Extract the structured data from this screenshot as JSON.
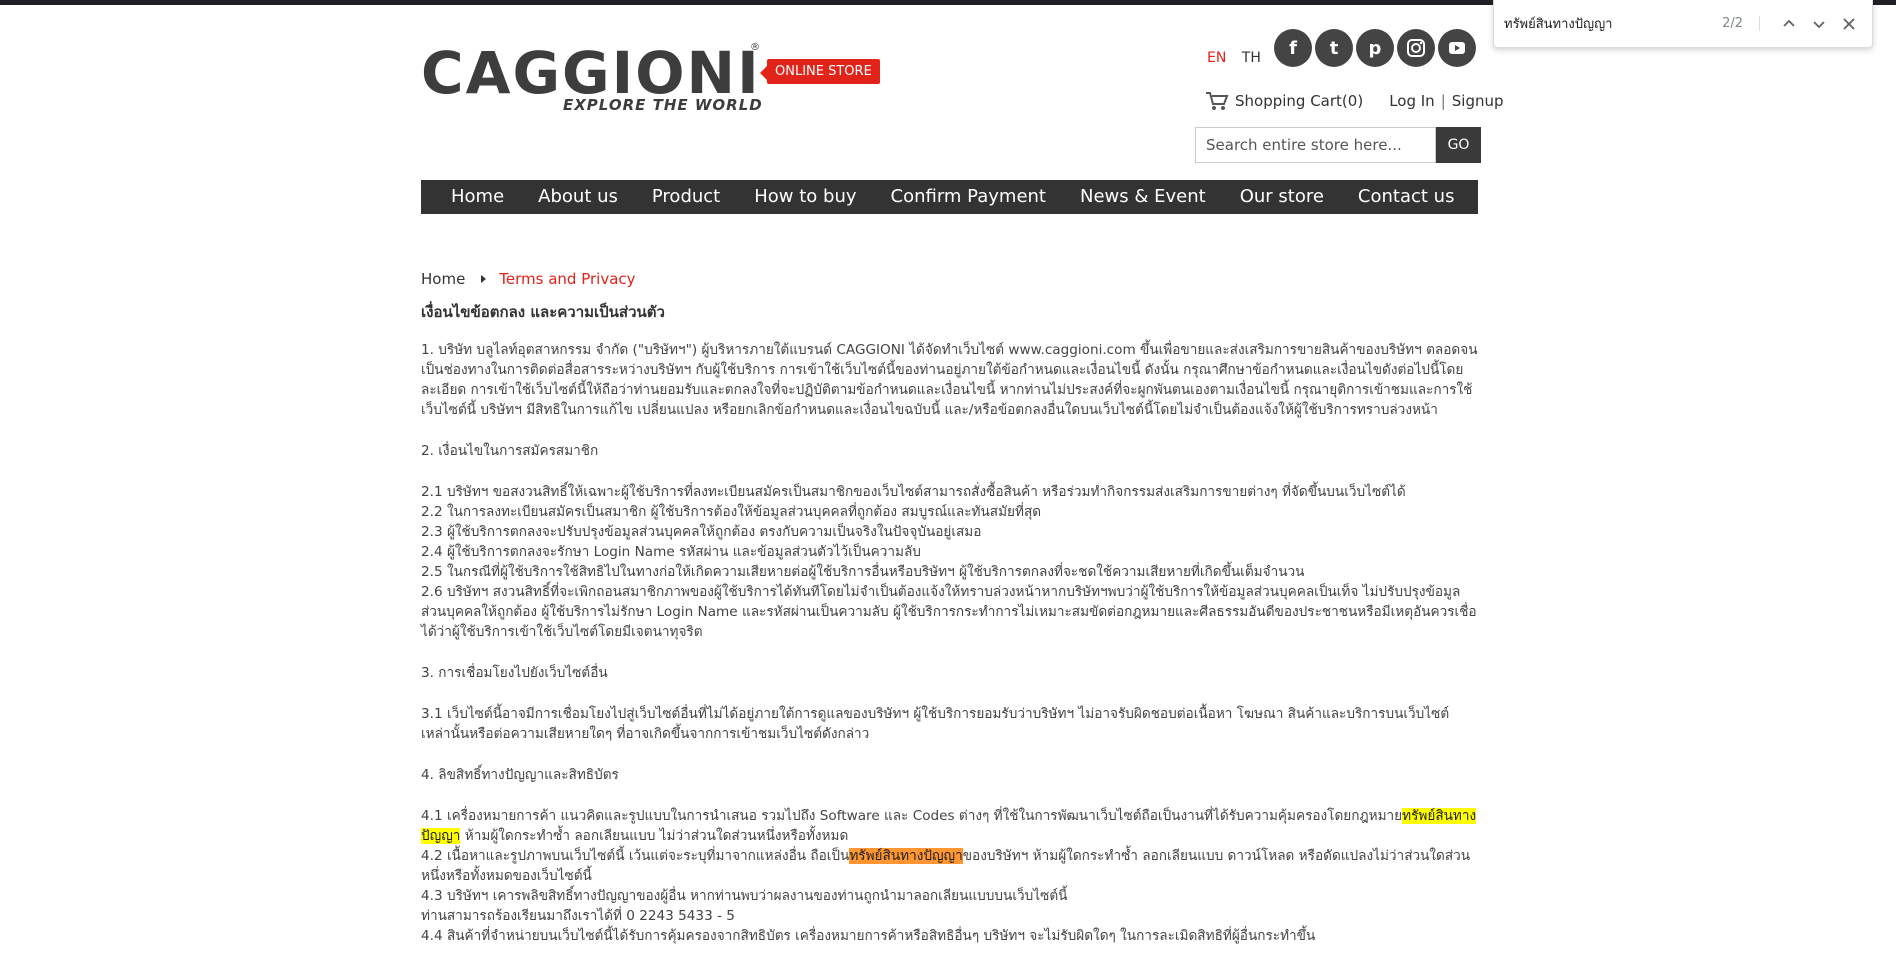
{
  "findbar": {
    "query": "ทรัพย์สินทางปัญญา",
    "count": "2/2",
    "icons": [
      "chevron-up-icon",
      "chevron-down-icon",
      "close-icon"
    ]
  },
  "header": {
    "logo_text": "CAGGIONI",
    "logo_reg": "®",
    "logo_tagline": "EXPLORE THE WORLD",
    "online_badge": "ONLINE STORE",
    "lang_en": "EN",
    "lang_th": "TH",
    "lang_active_color": "#e2231a",
    "social": [
      {
        "icon": "facebook-icon",
        "glyph": "f"
      },
      {
        "icon": "tumblr-icon",
        "glyph": "t"
      },
      {
        "icon": "pinterest-icon",
        "glyph": "p"
      },
      {
        "icon": "instagram-icon",
        "glyph": ""
      },
      {
        "icon": "youtube-icon",
        "glyph": ""
      }
    ],
    "cart_label": "Shopping Cart(0)",
    "login_label": "Log In",
    "signup_label": "Signup",
    "search_placeholder": "Search entire store here...",
    "search_button": "GO"
  },
  "nav": {
    "items": [
      "Home",
      "About us",
      "Product",
      "How to buy",
      "Confirm Payment",
      "News & Event",
      "Our store",
      "Contact us"
    ]
  },
  "breadcrumb": {
    "home": "Home",
    "current": "Terms and Privacy"
  },
  "doc": {
    "title": "เงื่อนไขข้อตกลง และความเป็นส่วนตัว",
    "p1": "1. บริษัท บลูไลท์อุตสาหกรรม จำกัด (\"บริษัทฯ\") ผู้บริหารภายใต้แบรนด์ CAGGIONI ได้จัดทำเว็บไซต์ www.caggioni.com ขึ้นเพื่อขายและส่งเสริมการขายสินค้าของบริษัทฯ ตลอดจนเป็นช่องทางในการติดต่อสื่อสารระหว่างบริษัทฯ กับผู้ใช้บริการ การเข้าใช้เว็บไซต์นี้ของท่านอยู่ภายใต้ข้อกำหนดและเงื่อนไขนี้ ดังนั้น กรุณาศึกษาข้อกำหนดและเงื่อนไขดังต่อไปนี้โดยละเอียด การเข้าใช้เว็บไซต์นี้ให้ถือว่าท่านยอมรับและตกลงใจที่จะปฏิบัติตามข้อกำหนดและเงื่อนไขนี้ หากท่านไม่ประสงค์ที่จะผูกพันตนเองตามเงื่อนไขนี้ กรุณายุติการเข้าชมและการใช้เว็บไซต์นี้ บริษัทฯ มีสิทธิในการแก้ไข เปลี่ยนแปลง หรือยกเลิกข้อกำหนดและเงื่อนไขฉบับนี้ และ/หรือข้อตกลงอื่นใดบนเว็บไซต์นี้โดยไม่จำเป็นต้องแจ้งให้ผู้ใช้บริการทราบล่วงหน้า",
    "h2": "2. เงื่อนไขในการสมัครสมาชิก",
    "p2_1": "2.1 บริษัทฯ ขอสงวนสิทธิ์ให้เฉพาะผู้ใช้บริการที่ลงทะเบียนสมัครเป็นสมาชิกของเว็บไซต์สามารถสั่งซื้อสินค้า หรือร่วมทำกิจกรรมส่งเสริมการขายต่างๆ ที่จัดขึ้นบนเว็บไซต์ได้",
    "p2_2": "2.2 ในการลงทะเบียนสมัครเป็นสมาชิก ผู้ใช้บริการต้องให้ข้อมูลส่วนบุคคลที่ถูกต้อง สมบูรณ์และทันสมัยที่สุด",
    "p2_3": "2.3 ผู้ใช้บริการตกลงจะปรับปรุงข้อมูลส่วนบุคคลให้ถูกต้อง ตรงกับความเป็นจริงในปัจจุบันอยู่เสมอ",
    "p2_4": "2.4 ผู้ใช้บริการตกลงจะรักษา Login Name รหัสผ่าน และข้อมูลส่วนตัวไว้เป็นความลับ",
    "p2_5": "2.5 ในกรณีที่ผู้ใช้บริการใช้สิทธิไปในทางก่อให้เกิดความเสียหายต่อผู้ใช้บริการอื่นหรือบริษัทฯ ผู้ใช้บริการตกลงที่จะชดใช้ความเสียหายที่เกิดขึ้นเต็มจำนวน",
    "p2_6": "2.6 บริษัทฯ สงวนสิทธิ์ที่จะเพิกถอนสมาชิกภาพของผู้ใช้บริการได้ทันทีโดยไม่จำเป็นต้องแจ้งให้ทราบล่วงหน้าหากบริษัทฯพบว่าผู้ใช้บริการให้ข้อมูลส่วนบุคคลเป็นเท็จ ไม่ปรับปรุงข้อมูลส่วนบุคคลให้ถูกต้อง ผู้ใช้บริการไม่รักษา Login Name และรหัสผ่านเป็นความลับ ผู้ใช้บริการกระทำการไม่เหมาะสมขัดต่อกฎหมายและศีลธรรมอันดีของประชาชนหรือมีเหตุอันควรเชื่อได้ว่าผู้ใช้บริการเข้าใช้เว็บไซต์โดยมีเจตนาทุจริต",
    "h3": "3. การเชื่อมโยงไปยังเว็บไซต์อื่น",
    "p3_1": "3.1 เว็บไซต์นี้อาจมีการเชื่อมโยงไปสู่เว็บไซต์อื่นที่ไม่ได้อยู่ภายใต้การดูแลของบริษัทฯ ผู้ใช้บริการยอมรับว่าบริษัทฯ ไม่อาจรับผิดชอบต่อเนื้อหา โฆษณา สินค้าและบริการบนเว็บไซต์เหล่านั้นหรือต่อความเสียหายใดๆ ที่อาจเกิดขึ้นจากการเข้าชมเว็บไซต์ดังกล่าว",
    "h4": "4. ลิขสิทธิ์ทางปัญญาและสิทธิบัตร",
    "p4_1_a": "4.1 เครื่องหมายการค้า แนวคิดและรูปแบบในการนำเสนอ รวมไปถึง Software และ Codes ต่างๆ ที่ใช้ในการพัฒนาเว็บไซต์ถือเป็นงานที่ได้รับความคุ้มครองโดยกฎหมาย",
    "p4_1_hl": "ทรัพย์สินทางปัญญา",
    "p4_1_b": " ห้ามผู้ใดกระทำซ้ำ ลอกเลียนแบบ ไม่ว่าส่วนใดส่วนหนึ่งหรือทั้งหมด",
    "p4_2_a": "4.2 เนื้อหาและรูปภาพบนเว็บไซต์นี้ เว้นแต่จะระบุที่มาจากแหล่งอื่น ถือเป็น",
    "p4_2_hl": "ทรัพย์สินทางปัญญา",
    "p4_2_b": "ของบริษัทฯ ห้ามผู้ใดกระทำซ้ำ ลอกเลียนแบบ ดาวน์โหลด หรือดัดแปลงไม่ว่าส่วนใดส่วนหนึ่งหรือทั้งหมดของเว็บไซต์นี้",
    "p4_3": "4.3 บริษัทฯ เคารพลิขสิทธิ์ทางปัญญาของผู้อื่น หากท่านพบว่าผลงานของท่านถูกนำมาลอกเลียนแบบบนเว็บไซต์นี้",
    "p4_3b": "ท่านสามารถร้องเรียนมาถึงเราได้ที่ 0 2243 5433 - 5",
    "p4_4": "4.4 สินค้าที่จำหน่ายบนเว็บไซต์นี้ได้รับการคุ้มครองจากสิทธิบัตร เครื่องหมายการค้าหรือสิทธิอื่นๆ บริษัทฯ จะไม่รับผิดใดๆ ในการละเมิดสิทธิที่ผู้อื่นกระทำขึ้น"
  },
  "colors": {
    "accent": "#e2231a",
    "nav_bg": "#333333",
    "find_highlight": "#ffff00",
    "find_active": "#ff9632"
  }
}
